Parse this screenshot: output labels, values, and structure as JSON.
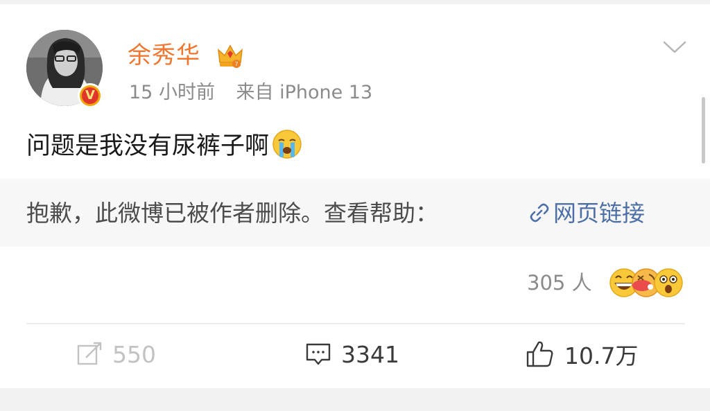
{
  "post": {
    "username": "余秀华",
    "time": "15 小时前",
    "source": "来自 iPhone 13",
    "text": "问题是我没有尿裤子啊",
    "verified_badge": "V"
  },
  "deleted_notice": {
    "text": "抱歉，此微博已被作者删除。查看帮助：",
    "link_label": "网页链接"
  },
  "reactions": {
    "count_label": "305 人"
  },
  "actions": {
    "repost_count": "550",
    "comment_count": "3341",
    "like_count": "10.7万"
  },
  "colors": {
    "username": "#f0762f",
    "link": "#4d6fa8",
    "meta": "#8b8b8b"
  },
  "icons": {
    "crown": "crown-icon",
    "chevron": "chevron-down-icon",
    "crying": "crying-emoji-icon",
    "link": "link-icon",
    "repost": "repost-icon",
    "comment": "comment-icon",
    "like": "thumbs-up-icon"
  }
}
